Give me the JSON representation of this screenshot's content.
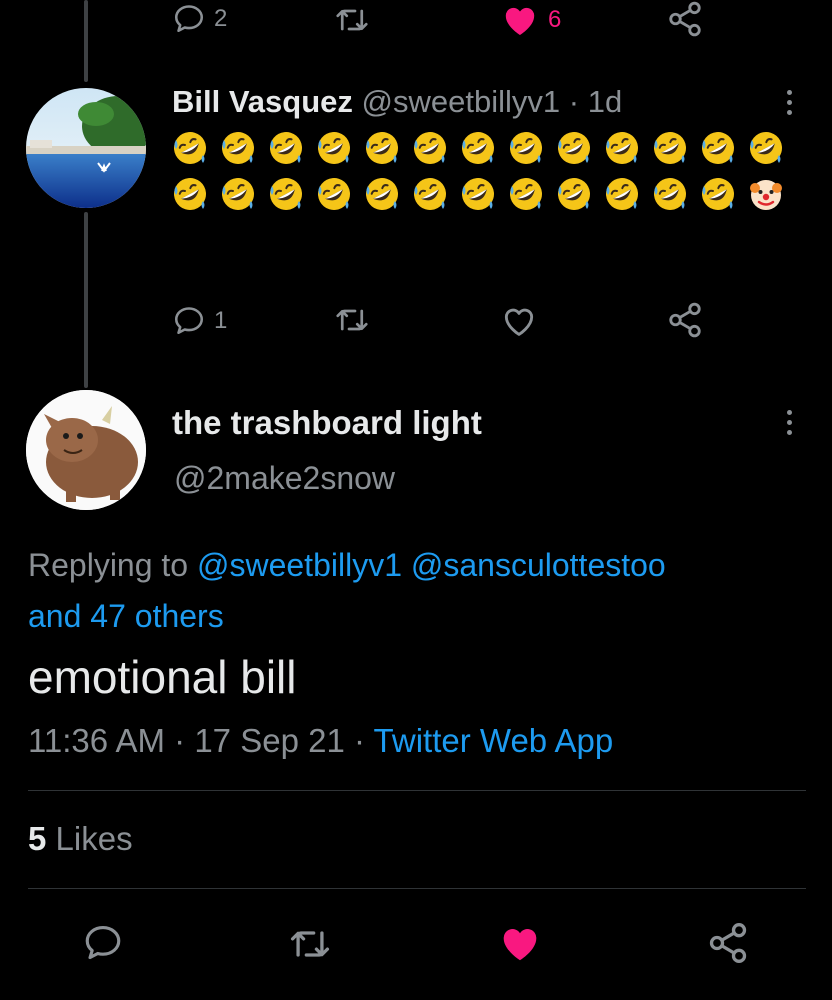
{
  "prev_tweet": {
    "reply_count": "2",
    "like_count": "6",
    "liked": true
  },
  "tweet1": {
    "name": "Bill Vasquez",
    "handle": "@sweetbillyv1",
    "separator": "·",
    "time": "1d",
    "emoji_sequence": [
      "rofl",
      "rofl",
      "rofl",
      "rofl",
      "rofl",
      "rofl",
      "rofl",
      "rofl",
      "rofl",
      "rofl",
      "rofl",
      "rofl",
      "rofl",
      "rofl",
      "rofl",
      "rofl",
      "rofl",
      "rofl",
      "rofl",
      "rofl",
      "rofl",
      "rofl",
      "rofl",
      "rofl",
      "rofl",
      "clown"
    ],
    "reply_count": "1"
  },
  "tweet2": {
    "name": "the trashboard light",
    "handle": "@2make2snow",
    "replying_prefix": "Replying to",
    "reply_handles": [
      "@sweetbillyv1",
      "@sansculottestoo"
    ],
    "reply_others": "and 47 others",
    "text": "emotional bill",
    "time": "11:36 AM",
    "sep": "·",
    "date": "17 Sep 21",
    "source": "Twitter Web App",
    "likes_count": "5",
    "likes_label": "Likes"
  },
  "colors": {
    "like": "#f91880",
    "link": "#1d9bf0",
    "muted": "#8b9095"
  },
  "icons": [
    "reply-icon",
    "retweet-icon",
    "like-icon",
    "share-icon",
    "more-icon"
  ]
}
